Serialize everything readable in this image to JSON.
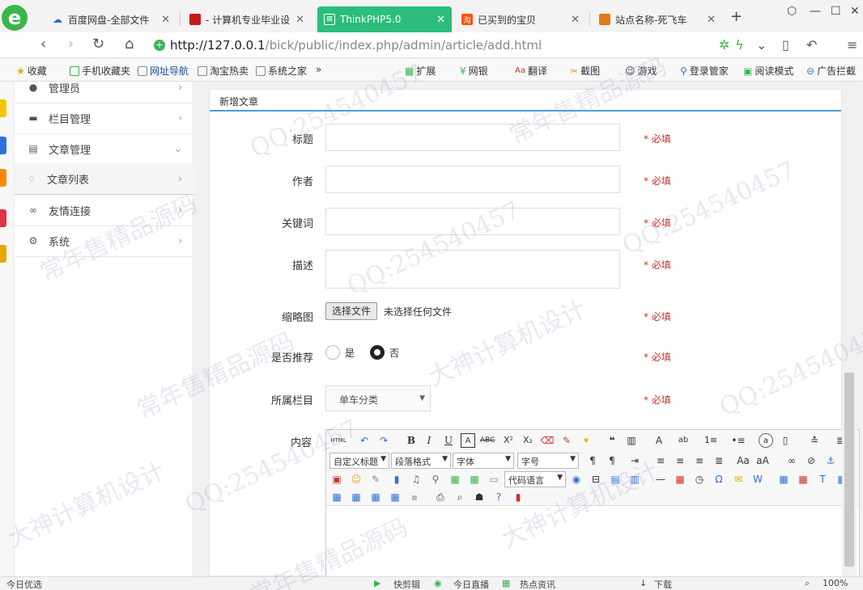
{
  "browser": {
    "tabs": [
      {
        "title": "百度网盘-全部文件",
        "color": "#2f6fd8",
        "icon": "cloud-icon"
      },
      {
        "title": "- 计算机专业毕业设",
        "color": "#c41a1a",
        "icon": "flag-icon"
      },
      {
        "title": "ThinkPHP5.0",
        "color": "#ffffff",
        "icon": "thinkphp-icon"
      },
      {
        "title": "已买到的宝贝",
        "color": "#ff5000",
        "icon": "taobao-icon"
      },
      {
        "title": "站点名称-死飞车",
        "color": "#e07a16",
        "icon": "site-icon"
      }
    ],
    "url_host": "http://127.0.0.1",
    "url_path": "/bick/public/index.php/admin/article/add.html",
    "bookmarks": [
      "收藏",
      "手机收藏夹",
      "网址导航",
      "淘宝热卖",
      "系统之家",
      "»"
    ],
    "toolbar_right": [
      "扩展",
      "网银",
      "翻译",
      "截图",
      "游戏",
      "登录管家",
      "阅读模式",
      "广告拦截"
    ]
  },
  "sidebar": {
    "items": [
      {
        "label": "管理员",
        "icon": "user-icon"
      },
      {
        "label": "栏目管理",
        "icon": "folder-icon"
      },
      {
        "label": "文章管理",
        "icon": "document-icon"
      },
      {
        "label": "文章列表",
        "icon": "dot-icon"
      },
      {
        "label": "友情连接",
        "icon": "link-icon"
      },
      {
        "label": "系统",
        "icon": "gear-icon"
      }
    ]
  },
  "panel": {
    "title": "新增文章"
  },
  "form": {
    "title_label": "标题",
    "author_label": "作者",
    "keywords_label": "关键词",
    "desc_label": "描述",
    "thumb_label": "缩略图",
    "file_button": "选择文件",
    "file_status": "未选择任何文件",
    "recommend_label": "是否推荐",
    "yes_label": "是",
    "no_label": "否",
    "category_label": "所属栏目",
    "category_value": "单车分类",
    "content_label": "内容",
    "required": "* 必填"
  },
  "editor": {
    "html_btn": "HTML",
    "custom_title": "自定义标题",
    "paragraph": "段落格式",
    "font": "字体",
    "font_size": "字号",
    "code_lang": "代码语言"
  },
  "statusbar": {
    "left": "今日优选",
    "items": [
      "快剪辑",
      "今日直播",
      "热点资讯"
    ],
    "download": "下载",
    "zoom": "100%"
  },
  "watermarks": [
    "QQ:254540457",
    "常年售精品源码",
    "大神计算机设计"
  ]
}
